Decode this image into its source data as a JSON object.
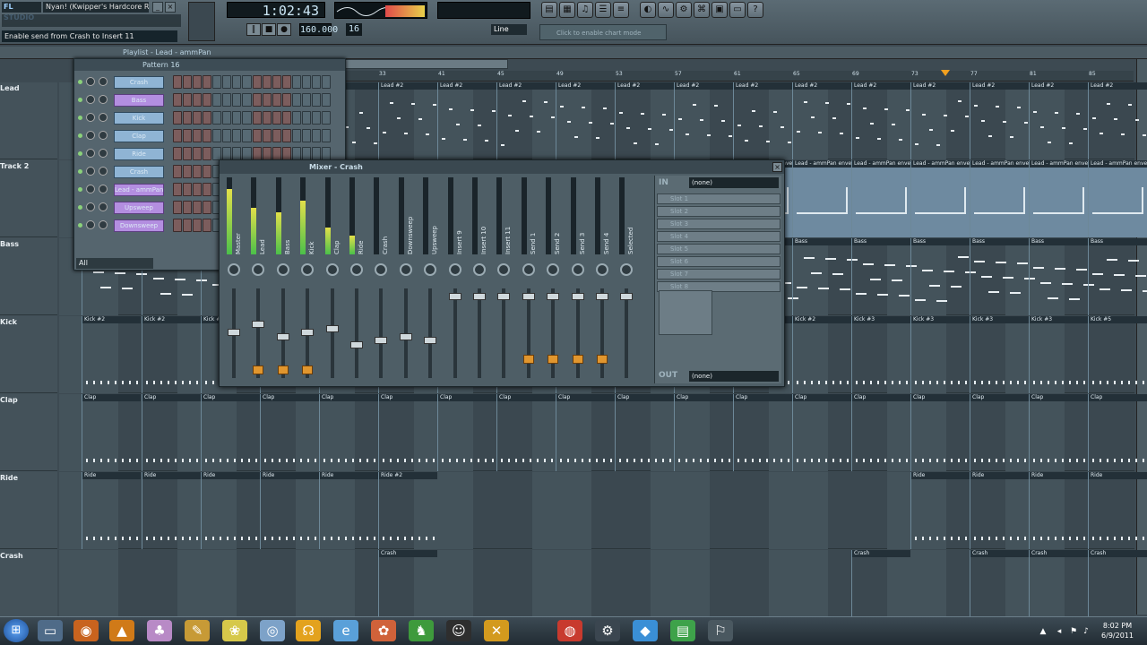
{
  "window": {
    "app_logo": "FL STUDIO",
    "song_title": "Nyan! (Kwipper's Hardcore Re...",
    "hint_bar": "Enable send from Crash to Insert 11",
    "time_display": "1:02:43",
    "tempo": "160.000",
    "pattern_number": "16",
    "snap": "Line",
    "hint_panel": "Click to enable chart mode"
  },
  "playlist": {
    "title": "Playlist - Lead - ammPan",
    "ruler": [
      "33",
      "41",
      "45",
      "49",
      "53",
      "57",
      "61",
      "65",
      "69",
      "73",
      "77",
      "81",
      "85"
    ],
    "tracks": [
      {
        "label": "Lead",
        "clip_label": "Lead #2"
      },
      {
        "label": "Track 2",
        "clip_label": "Lead - ammPan envelope"
      },
      {
        "label": "Bass",
        "clip_label": "Bass"
      },
      {
        "label": "Kick",
        "clip_label": "Kick #2"
      },
      {
        "label": "Clap",
        "clip_label": "Clap"
      },
      {
        "label": "Ride",
        "clip_label": "Ride"
      },
      {
        "label": "Crash",
        "clip_label": "Crash"
      }
    ],
    "extra_clip_labels": {
      "kick_right": "Kick #3",
      "kick_far": "Kick #5",
      "ride_2": "Ride #2"
    }
  },
  "channel_rack": {
    "title": "Pattern 16",
    "channels": [
      {
        "name": "Crash",
        "selected": false
      },
      {
        "name": "Bass",
        "selected": true
      },
      {
        "name": "Kick",
        "selected": false
      },
      {
        "name": "Clap",
        "selected": false
      },
      {
        "name": "Ride",
        "selected": false
      },
      {
        "name": "Crash",
        "selected": false
      },
      {
        "name": "Lead - ammPan",
        "selected": true
      },
      {
        "name": "Upsweep",
        "selected": true
      },
      {
        "name": "Downsweep",
        "selected": true
      }
    ],
    "filter": "All"
  },
  "mixer": {
    "title": "Mixer - Crash",
    "strips": [
      {
        "name": "Master",
        "level": 0.85,
        "fader": 0.5
      },
      {
        "name": "Lead",
        "level": 0.6,
        "fader": 0.6
      },
      {
        "name": "Bass",
        "level": 0.55,
        "fader": 0.45
      },
      {
        "name": "Kick",
        "level": 0.7,
        "fader": 0.5
      },
      {
        "name": "Clap",
        "level": 0.35,
        "fader": 0.55
      },
      {
        "name": "Ride",
        "level": 0.25,
        "fader": 0.35
      },
      {
        "name": "Crash",
        "level": 0.0,
        "fader": 0.4
      },
      {
        "name": "Downsweep",
        "level": 0.0,
        "fader": 0.45
      },
      {
        "name": "Upsweep",
        "level": 0.0,
        "fader": 0.4
      },
      {
        "name": "Insert 9",
        "level": 0.0,
        "fader": 0.95
      },
      {
        "name": "Insert 10",
        "level": 0.0,
        "fader": 0.95
      },
      {
        "name": "Insert 11",
        "level": 0.0,
        "fader": 0.95
      },
      {
        "name": "Send 1",
        "level": 0.0,
        "fader": 0.95
      },
      {
        "name": "Send 2",
        "level": 0.0,
        "fader": 0.95
      },
      {
        "name": "Send 3",
        "level": 0.0,
        "fader": 0.95
      },
      {
        "name": "Send 4",
        "level": 0.0,
        "fader": 0.95
      },
      {
        "name": "Selected",
        "level": 0.0,
        "fader": 0.95
      }
    ],
    "input": "(none)",
    "output": "(none)",
    "fx_slots": [
      "Slot 1",
      "Slot 2",
      "Slot 3",
      "Slot 4",
      "Slot 5",
      "Slot 6",
      "Slot 7",
      "Slot 8"
    ],
    "in_label": "IN",
    "out_label": "OUT"
  },
  "taskbar": {
    "time": "8:02 PM",
    "date": "6/9/2011"
  }
}
